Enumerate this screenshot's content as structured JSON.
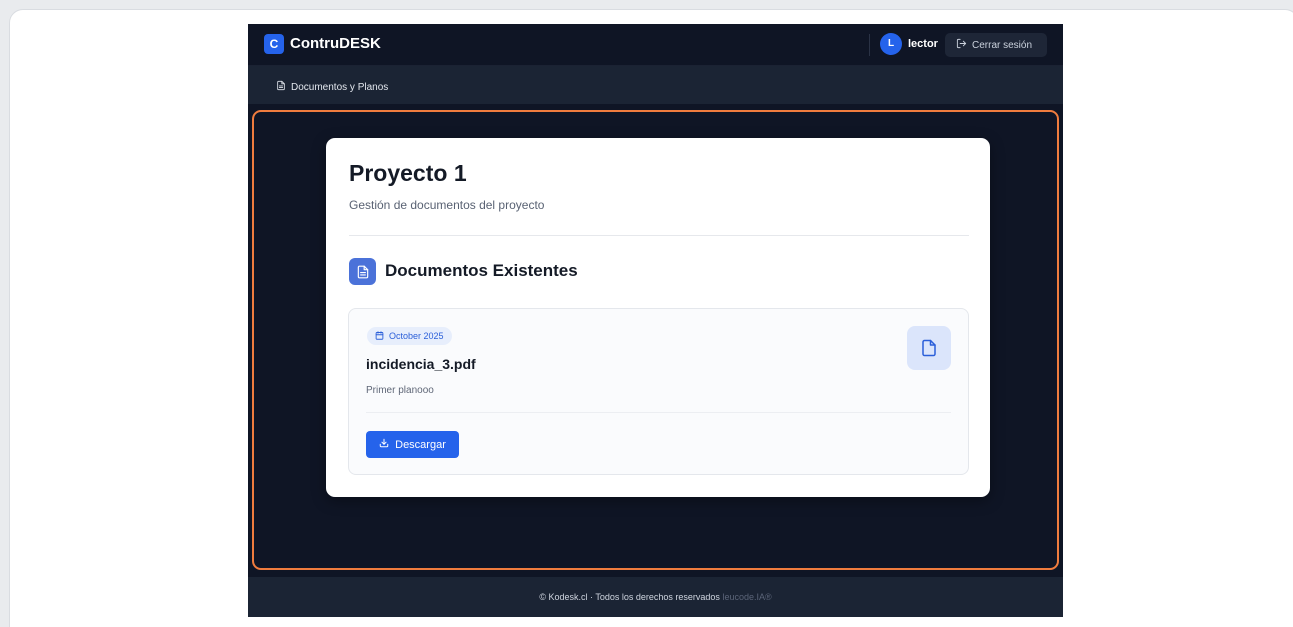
{
  "app": {
    "logo_letter": "C",
    "name": "ContruDESK"
  },
  "user": {
    "initial": "L",
    "name": "lector"
  },
  "topbar": {
    "logout_label": "Cerrar sesión"
  },
  "subnav": {
    "item_label": "Documentos y Planos"
  },
  "project": {
    "title": "Proyecto 1",
    "subtitle": "Gestión de documentos del proyecto"
  },
  "documents": {
    "section_title": "Documentos Existentes",
    "items": [
      {
        "date": "October 2025",
        "file_name": "incidencia_3.pdf",
        "description": "Primer planooo",
        "download_label": "Descargar"
      }
    ]
  },
  "footer": {
    "text": "© Kodesk.cl · Todos los derechos reservados",
    "brand": "leucode.IA®"
  },
  "colors": {
    "accent": "#2563eb",
    "highlight_border": "#f07c3e",
    "app_background": "#0f1525"
  }
}
